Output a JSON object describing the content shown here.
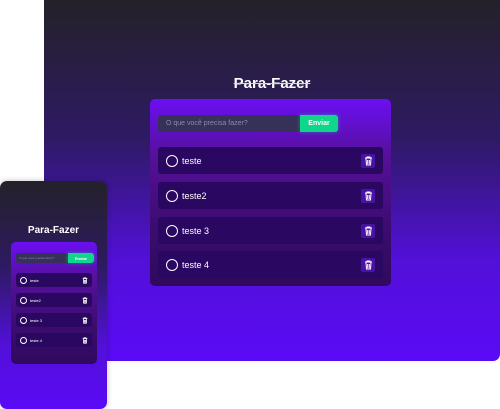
{
  "app": {
    "title": "Para-Fazer",
    "input_placeholder": "O que você precisa fazer?",
    "submit_label": "Enviar"
  },
  "tasks": [
    {
      "text": "teste"
    },
    {
      "text": "teste2"
    },
    {
      "text": "teste 3"
    },
    {
      "text": "teste 4"
    }
  ],
  "icons": {
    "task_toggle": "circle-icon",
    "task_delete": "trash-icon"
  },
  "colors": {
    "accent": "#0fd68a",
    "task_bg": "#2a0761",
    "input_bg": "#363158"
  }
}
